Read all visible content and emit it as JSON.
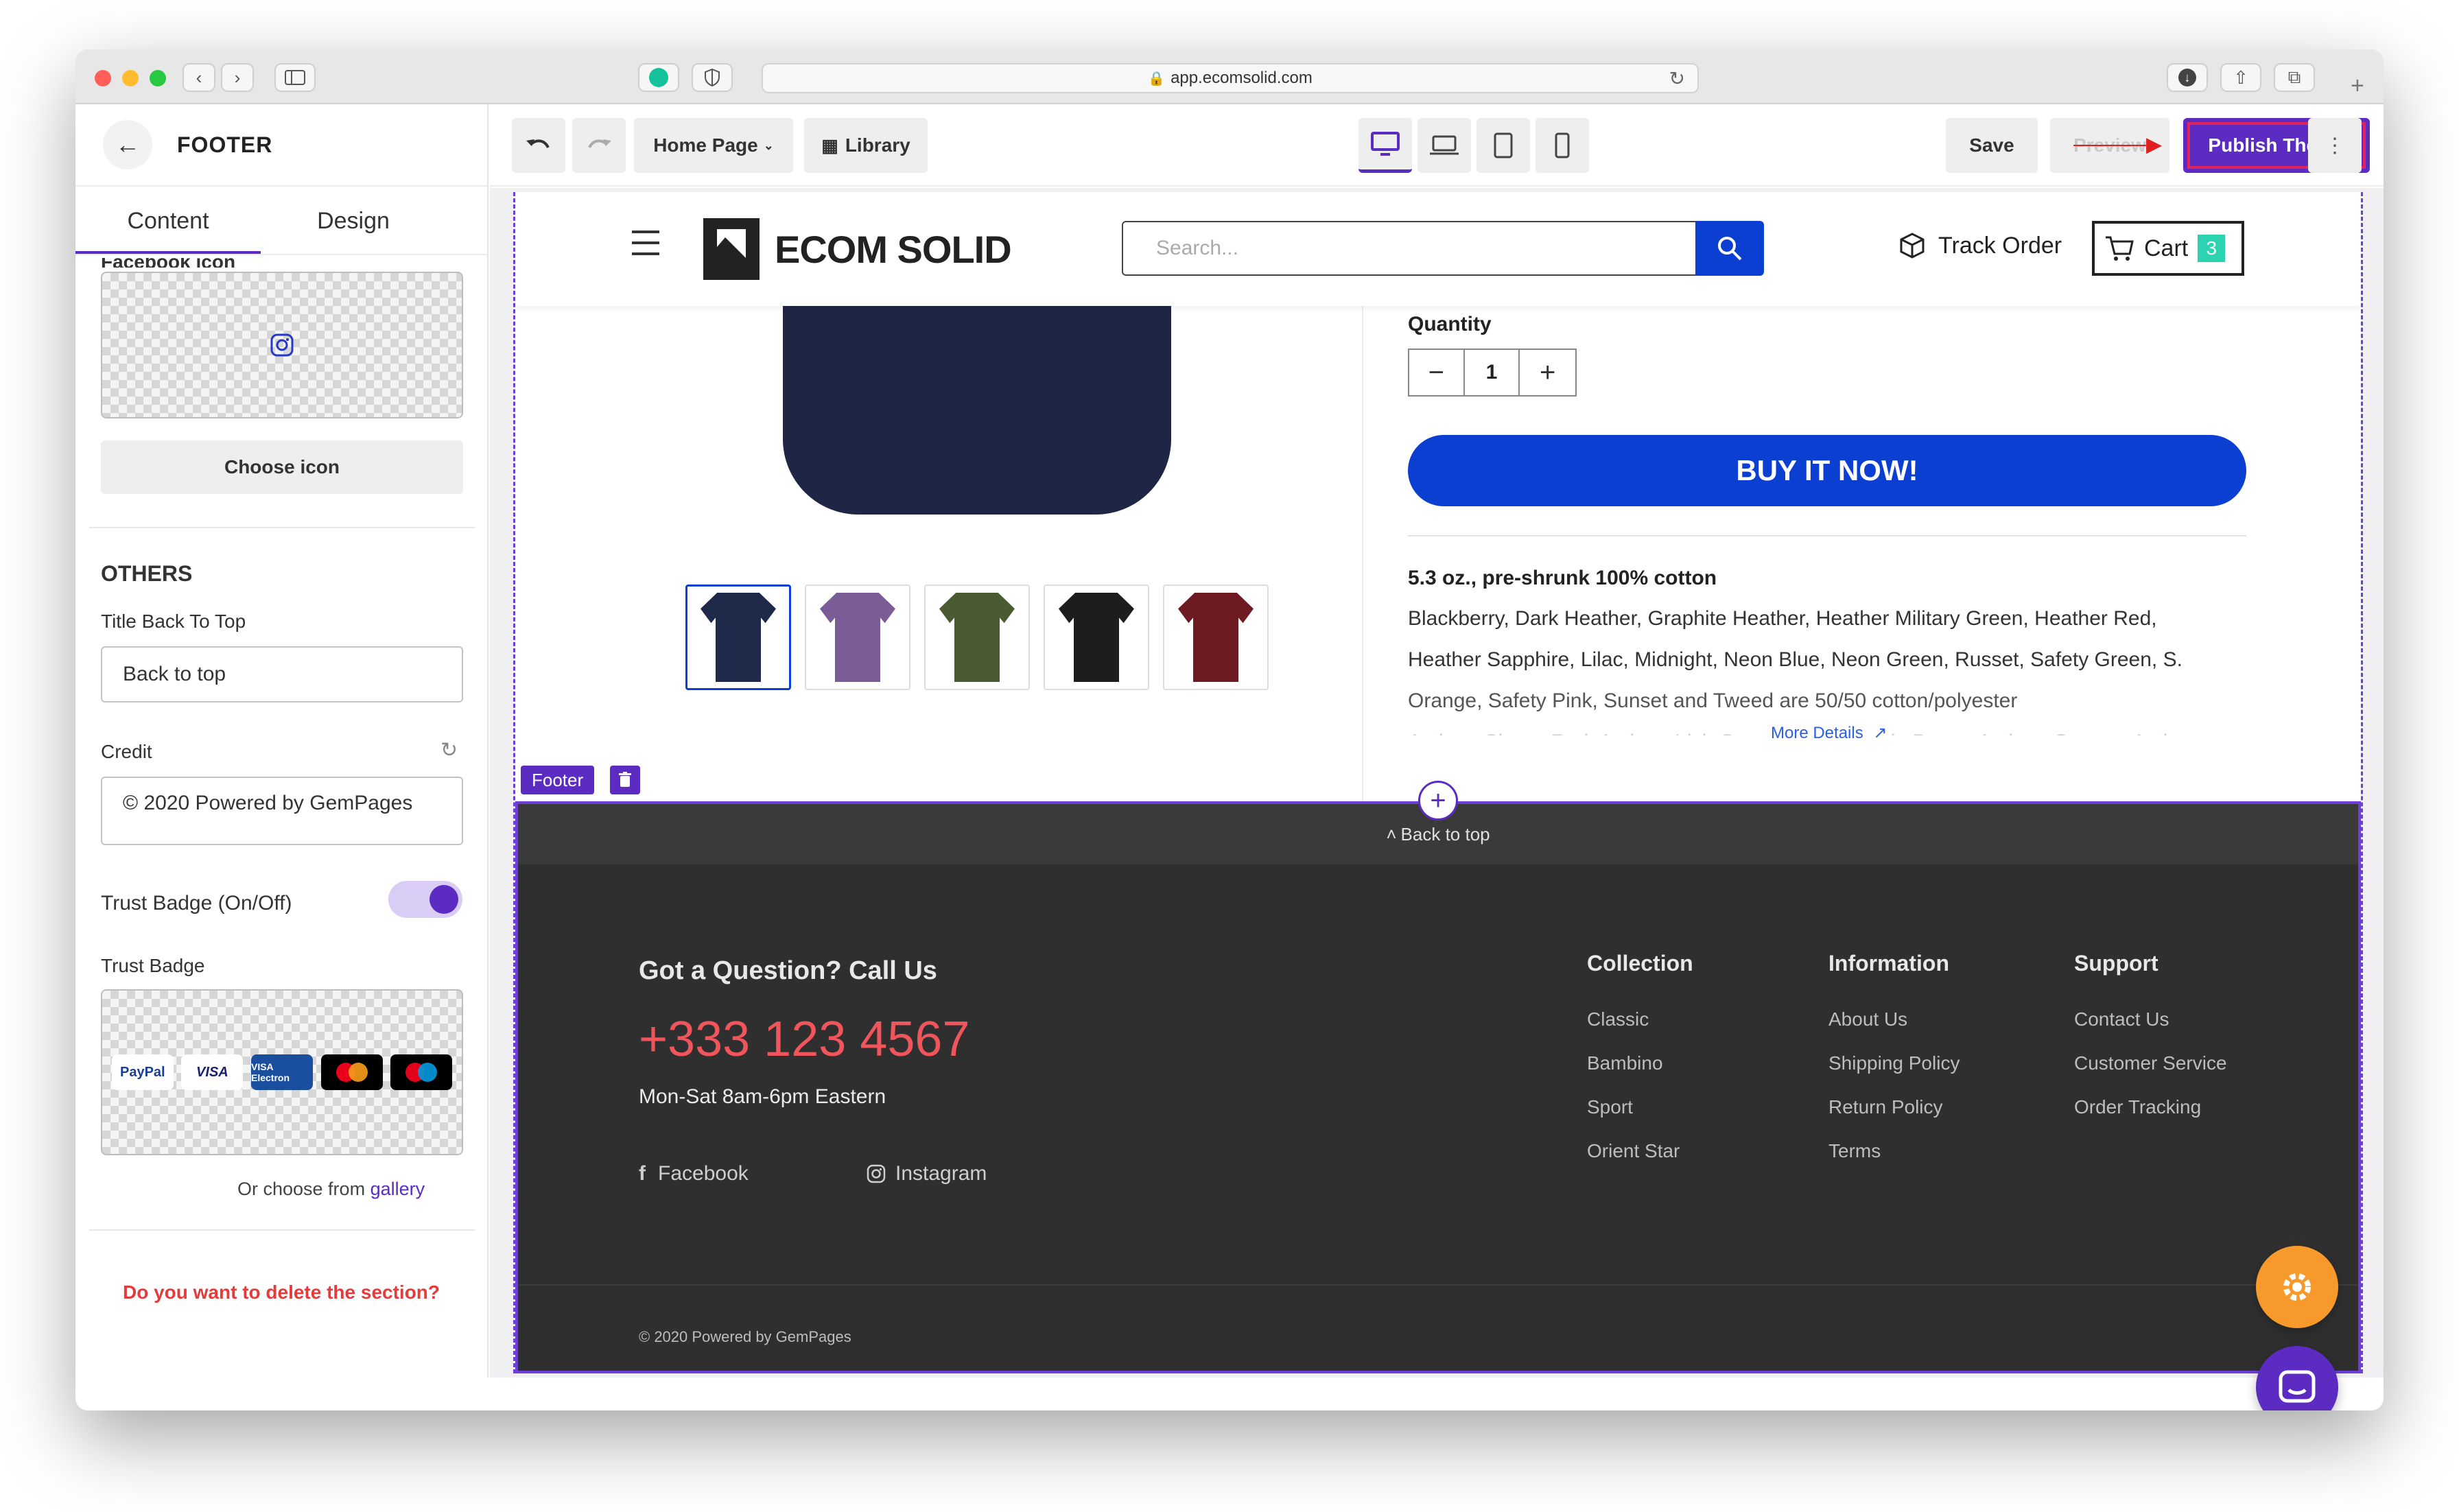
{
  "browser": {
    "url": "app.ecomsolid.com"
  },
  "sidebar": {
    "title": "FOOTER",
    "tabs": [
      "Content",
      "Design"
    ],
    "facebook_icon_label": "Facebook icon",
    "choose_icon_label": "Choose icon",
    "others_heading": "OTHERS",
    "title_back_to_top_label": "Title Back To Top",
    "title_back_to_top_value": "Back to top",
    "credit_label": "Credit",
    "credit_value": "© 2020 Powered by GemPages",
    "trust_badge_toggle_label": "Trust Badge (On/Off)",
    "trust_badge_toggle_on": true,
    "trust_badge_label": "Trust Badge",
    "gallery_prefix": "Or choose from",
    "gallery_link": "gallery",
    "delete_prompt": "Do you want to delete the section?"
  },
  "toolbar": {
    "page_select": "Home Page",
    "library_label": "Library",
    "save_label": "Save",
    "preview_label": "Preview",
    "publish_label": "Publish Theme",
    "active_device": "desktop"
  },
  "store": {
    "logo_text": "ECOM SOLID",
    "search_placeholder": "Search...",
    "track_order_label": "Track Order",
    "cart_label": "Cart",
    "cart_count": "3",
    "quantity_label": "Quantity",
    "quantity_value": "1",
    "buy_now_label": "BUY IT NOW!",
    "desc_heading": "5.3 oz., pre-shrunk 100% cotton",
    "desc_lines": [
      "Blackberry, Dark Heather, Graphite Heather, Heather Military Green, Heather Red,",
      "Heather Sapphire, Lilac, Midnight, Neon Blue, Neon Green, Russet, Safety Green, S.",
      "Orange, Safety Pink, Sunset and Tweed are 50/50 cotton/polyester",
      "Antique Cherry Red, Antique Irish Green, Antique Jade Dome, Antique Orange, Antique"
    ],
    "more_details_label": "More Details",
    "thumbnail_colors": [
      "#1f2a4a",
      "#7a5c96",
      "#4a5a32",
      "#1d1d1d",
      "#6e1a22"
    ]
  },
  "section_tag": "Footer",
  "footer": {
    "back_to_top": "Back to top",
    "question_heading": "Got a Question? Call Us",
    "phone": "+333 123 4567",
    "hours": "Mon-Sat 8am-6pm Eastern",
    "social": [
      "Facebook",
      "Instagram"
    ],
    "columns": [
      {
        "heading": "Collection",
        "links": [
          "Classic",
          "Bambino",
          "Sport",
          "Orient Star"
        ]
      },
      {
        "heading": "Information",
        "links": [
          "About Us",
          "Shipping Policy",
          "Return Policy",
          "Terms"
        ]
      },
      {
        "heading": "Support",
        "links": [
          "Contact Us",
          "Customer Service",
          "Order Tracking"
        ]
      }
    ],
    "copyright": "© 2020 Powered by GemPages",
    "phone_color": "#f0555b"
  },
  "colors": {
    "accent": "#5b2bc2",
    "buy_button": "#0b3fd1",
    "footer_bg": "#2f2f2f",
    "back_to_top_bg": "#3a3a3a",
    "cart_badge": "#2bd3b0",
    "gear_fab": "#f79a2b"
  }
}
